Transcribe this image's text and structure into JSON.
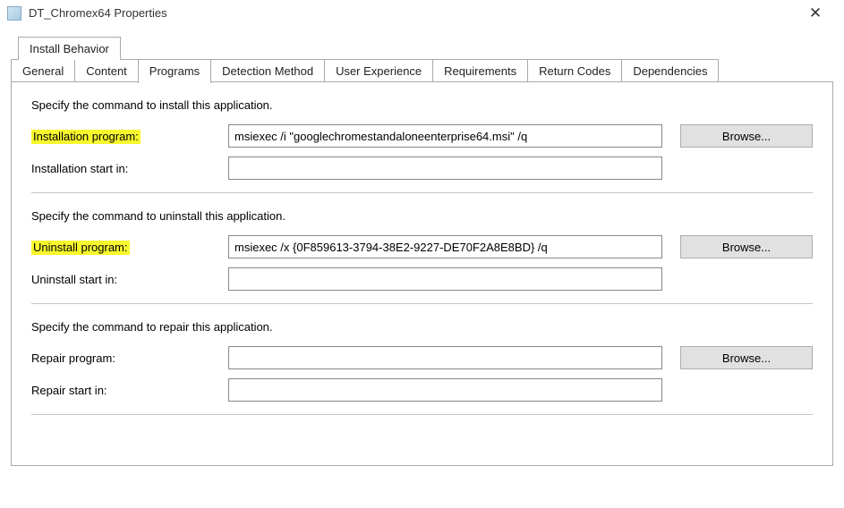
{
  "window": {
    "title": "DT_Chromex64 Properties"
  },
  "tabs": {
    "upper": [
      {
        "label": "Install Behavior"
      }
    ],
    "lower": [
      {
        "label": "General"
      },
      {
        "label": "Content"
      },
      {
        "label": "Programs",
        "active": true,
        "highlighted": true
      },
      {
        "label": "Detection Method"
      },
      {
        "label": "User Experience"
      },
      {
        "label": "Requirements"
      },
      {
        "label": "Return Codes"
      },
      {
        "label": "Dependencies"
      }
    ]
  },
  "sections": {
    "install": {
      "desc": "Specify the command to install this application.",
      "program_label": "Installation program:",
      "program_value": "msiexec /i \"googlechromestandaloneenterprise64.msi\" /q",
      "startin_label": "Installation start in:",
      "startin_value": ""
    },
    "uninstall": {
      "desc": "Specify the command to uninstall this application.",
      "program_label": "Uninstall program:",
      "program_value": "msiexec /x {0F859613-3794-38E2-9227-DE70F2A8E8BD} /q",
      "startin_label": "Uninstall start in:",
      "startin_value": ""
    },
    "repair": {
      "desc": "Specify the command to repair this application.",
      "program_label": "Repair program:",
      "program_value": "",
      "startin_label": "Repair start in:",
      "startin_value": ""
    }
  },
  "buttons": {
    "browse": "Browse..."
  }
}
